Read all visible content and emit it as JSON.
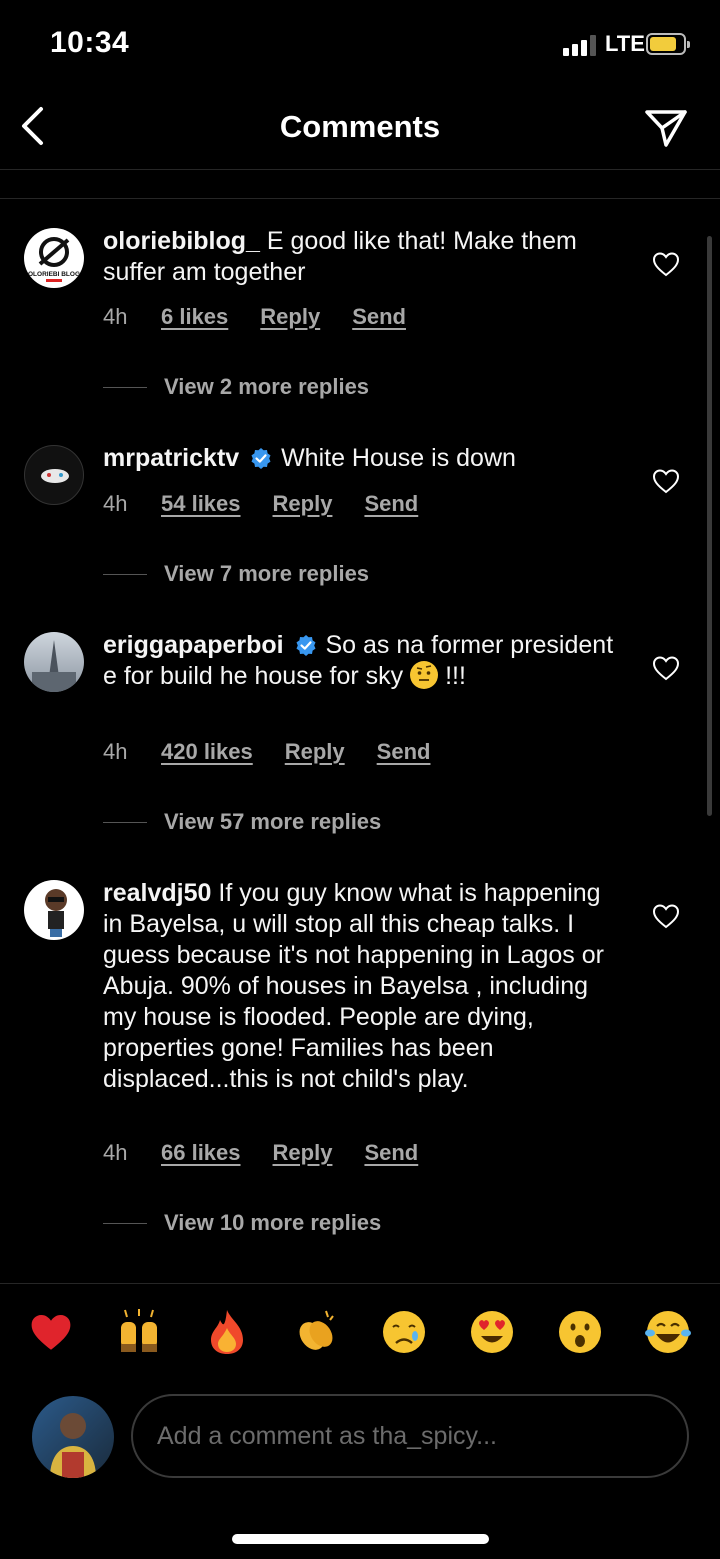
{
  "status_bar": {
    "time": "10:34",
    "network": "LTE"
  },
  "header": {
    "title": "Comments"
  },
  "comments": [
    {
      "username": "oloriebiblog_",
      "text": "E good like that! Make them suffer am together",
      "time": "4h",
      "likes": "6 likes",
      "reply": "Reply",
      "send": "Send",
      "view_replies": "View 2 more replies"
    },
    {
      "username": "mrpatricktv",
      "text": "White House is down",
      "time": "4h",
      "likes": "54 likes",
      "reply": "Reply",
      "send": "Send",
      "view_replies": "View 7 more replies"
    },
    {
      "username": "eriggapaperboi",
      "text": "So as na former president e for build he house for sky",
      "text_suffix": "!!!",
      "time": "4h",
      "likes": "420 likes",
      "reply": "Reply",
      "send": "Send",
      "view_replies": "View 57 more replies"
    },
    {
      "username": "realvdj50",
      "text": "If you guy know what is happening in Bayelsa, u will stop all this cheap talks. I guess because it's not happening in Lagos or Abuja. 90% of houses in Bayelsa , including my house is flooded. People are dying, properties gone! Families has been displaced...this is not child's play.",
      "time": "4h",
      "likes": "66 likes",
      "reply": "Reply",
      "send": "Send",
      "view_replies": "View 10 more replies"
    }
  ],
  "avatar_text": {
    "olorie": "OLORIEBI BLOG"
  },
  "emoji_bar": [
    "heart-emoji",
    "raising-hands-emoji",
    "fire-emoji",
    "clapping-emoji",
    "crying-emoji",
    "heart-eyes-emoji",
    "surprised-emoji",
    "laughing-emoji"
  ],
  "compose": {
    "placeholder": "Add a comment as tha_spicy..."
  },
  "colors": {
    "background": "#000000",
    "secondary_text": "#a8a8a8",
    "verified": "#3897f0",
    "battery": "#f2cc3c"
  }
}
